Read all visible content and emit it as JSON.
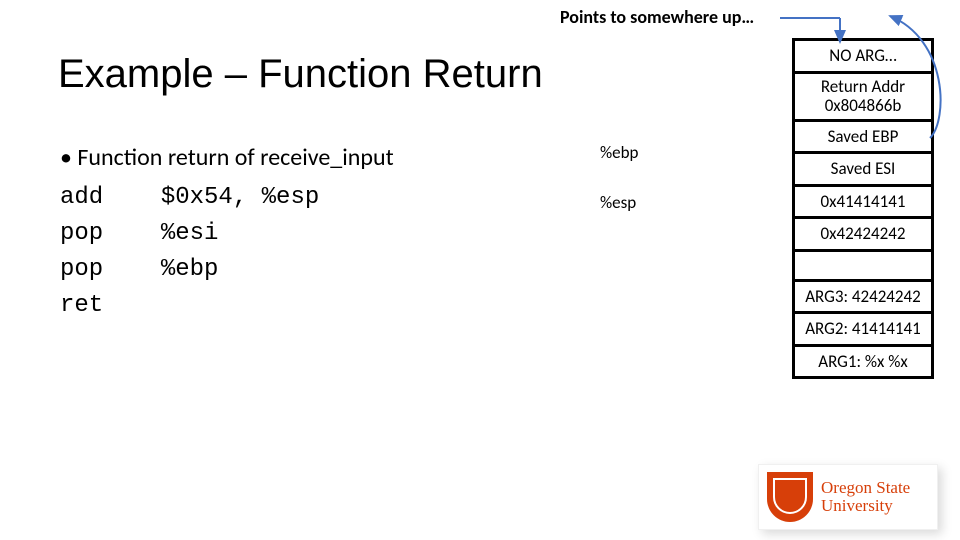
{
  "caption": "Points to somewhere up…",
  "title": "Example – Function Return",
  "bullet": "• Function return of receive_input",
  "code": {
    "l1": "add    $0x54, %esp",
    "l2": "pop    %esi",
    "l3": "pop    %ebp",
    "l4": "ret"
  },
  "reg": {
    "ebp": "%ebp",
    "esp": "%esp"
  },
  "stack": {
    "c0": "NO ARG…",
    "c1a": "Return Addr",
    "c1b": "0x804866b",
    "c2": "Saved EBP",
    "c3": "Saved ESI",
    "c4": "0x41414141",
    "c5": "0x42424242",
    "c7": "ARG3: 42424242",
    "c8": "ARG2: 41414141",
    "c9": "ARG1: %x %x"
  },
  "logo": {
    "line1": "Oregon State",
    "line2": "University"
  }
}
